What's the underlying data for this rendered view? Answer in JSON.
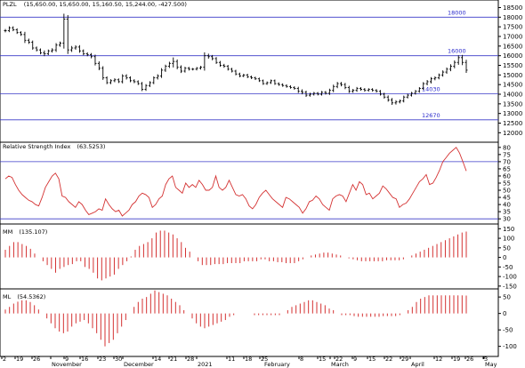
{
  "colors": {
    "hline": "#3a3ac8",
    "rsi": "#d43232",
    "bars": "#000000",
    "mm": "#d43232",
    "ml": "#d43232",
    "red_value": "#e00000",
    "frame": "#000000"
  },
  "panels": {
    "price": {
      "symbol": "PLZL",
      "ohlc": "(15,650.00, 15,650.00, 15,160.50, 15,244.00, -427.500)"
    },
    "rsi": {
      "name": "Relative Strength Index",
      "value": "(63.5253)"
    },
    "mm": {
      "name": "MM",
      "value": "(135.107)"
    },
    "ml": {
      "name": "ML",
      "value": "(54.5362)"
    }
  },
  "x_axis": {
    "labels": [
      "2",
      "19",
      "26",
      "November",
      "9",
      "16",
      "23",
      "30",
      "December",
      "14",
      "21",
      "28",
      "2021",
      "11",
      "18",
      "25",
      "February",
      "8",
      "15",
      "22",
      "March",
      "9",
      "15",
      "22",
      "29",
      "April",
      "12",
      "19",
      "26",
      "3",
      "May"
    ]
  },
  "chart_data": [
    {
      "type": "ohlc",
      "panel": "price",
      "ylim": [
        11600,
        18800
      ],
      "yticks": [
        12000,
        12500,
        13000,
        13500,
        14000,
        14500,
        15000,
        15500,
        16000,
        16500,
        17000,
        17500,
        18000,
        18500
      ],
      "levels": [
        {
          "value": 18000,
          "label": "18000"
        },
        {
          "value": 16000,
          "label": "16000"
        },
        {
          "value": 14030,
          "label": "14030"
        },
        {
          "value": 12670,
          "label": "12670"
        }
      ],
      "close": [
        17300,
        17450,
        17350,
        17200,
        17100,
        16800,
        16700,
        16400,
        16300,
        16150,
        16100,
        16250,
        16300,
        16550,
        16650,
        17900,
        16300,
        16400,
        16450,
        16250,
        16100,
        16050,
        15950,
        15600,
        15350,
        14850,
        14600,
        14700,
        14750,
        14650,
        14950,
        14850,
        14700,
        14650,
        14550,
        14250,
        14450,
        14600,
        14850,
        14950,
        15250,
        15450,
        15600,
        15700,
        15400,
        15200,
        15350,
        15300,
        15300,
        15350,
        15400,
        16000,
        15950,
        15850,
        15650,
        15500,
        15450,
        15300,
        15200,
        15050,
        14950,
        15000,
        14900,
        14850,
        14800,
        14700,
        14550,
        14600,
        14700,
        14550,
        14500,
        14450,
        14400,
        14350,
        14300,
        14150,
        14100,
        13950,
        14000,
        14050,
        14000,
        14100,
        14050,
        14200,
        14400,
        14550,
        14500,
        14350,
        14150,
        14200,
        14300,
        14250,
        14200,
        14250,
        14200,
        14150,
        14000,
        13850,
        13700,
        13550,
        13600,
        13650,
        13850,
        13950,
        14050,
        14150,
        14300,
        14550,
        14650,
        14800,
        14850,
        15000,
        15150,
        15300,
        15450,
        15650,
        15900,
        15650,
        15250
      ],
      "range": [
        240,
        220,
        220,
        200,
        200,
        400,
        250,
        250,
        220,
        220,
        350,
        200,
        250,
        300,
        250,
        800,
        600,
        300,
        250,
        280,
        220,
        220,
        250,
        300,
        300,
        300,
        220,
        220,
        220,
        200,
        250,
        250,
        220,
        220,
        200,
        250,
        220,
        220,
        220,
        250,
        300,
        250,
        250,
        600,
        300,
        280,
        220,
        200,
        180,
        180,
        200,
        500,
        300,
        250,
        220,
        220,
        220,
        200,
        200,
        200,
        200,
        180,
        180,
        180,
        180,
        180,
        180,
        180,
        180,
        180,
        180,
        180,
        180,
        180,
        180,
        250,
        300,
        250,
        220,
        200,
        180,
        200,
        200,
        250,
        280,
        250,
        250,
        250,
        250,
        220,
        220,
        200,
        200,
        180,
        180,
        180,
        200,
        220,
        250,
        300,
        250,
        220,
        220,
        200,
        200,
        200,
        200,
        220,
        250,
        250,
        220,
        220,
        250,
        250,
        300,
        300,
        350,
        400,
        400
      ]
    },
    {
      "type": "line",
      "panel": "rsi",
      "name": "Relative Strength Index",
      "ylim": [
        27,
        83
      ],
      "yticks": [
        30,
        35,
        40,
        45,
        50,
        55,
        60,
        65,
        70,
        75,
        80
      ],
      "levels": [
        70,
        30
      ],
      "values": [
        58,
        60,
        59,
        54,
        50,
        47,
        45,
        43,
        42,
        40,
        39,
        45,
        52,
        56,
        60,
        62,
        58,
        46,
        45,
        42,
        40,
        38,
        42,
        40,
        36,
        33,
        34,
        35,
        37,
        36,
        44,
        40,
        37,
        35,
        36,
        32,
        34,
        36,
        40,
        42,
        46,
        48,
        47,
        45,
        38,
        40,
        44,
        46,
        54,
        58,
        60,
        52,
        50,
        48,
        55,
        52,
        54,
        52,
        57,
        54,
        50,
        50,
        52,
        60,
        52,
        50,
        52,
        57,
        52,
        47,
        46,
        47,
        44,
        39,
        37,
        40,
        45,
        48,
        50,
        47,
        44,
        42,
        40,
        38,
        45,
        44,
        42,
        40,
        38,
        34,
        37,
        42,
        43,
        46,
        44,
        40,
        38,
        36,
        44,
        46,
        47,
        46,
        42,
        48,
        54,
        50,
        56,
        54,
        47,
        48,
        44,
        46,
        48,
        53,
        51,
        48,
        45,
        44,
        38,
        40,
        41,
        44,
        48,
        52,
        56,
        58,
        61,
        54,
        55,
        59,
        64,
        70,
        73,
        76,
        78,
        80,
        76,
        70,
        63.5
      ]
    },
    {
      "type": "bar",
      "panel": "mm",
      "name": "MM",
      "ylim": [
        -160,
        170
      ],
      "yticks": [
        150,
        100,
        50,
        0,
        -50,
        -100,
        -150
      ],
      "values": [
        40,
        60,
        80,
        80,
        70,
        60,
        45,
        20,
        0,
        -20,
        -40,
        -60,
        -80,
        -60,
        -50,
        -40,
        -35,
        -20,
        -20,
        -50,
        -60,
        -80,
        -110,
        -120,
        -110,
        -100,
        -90,
        -60,
        -40,
        -20,
        5,
        40,
        60,
        70,
        80,
        100,
        130,
        140,
        140,
        130,
        120,
        100,
        80,
        50,
        30,
        0,
        -20,
        -40,
        -40,
        -40,
        -35,
        -35,
        -35,
        -30,
        -30,
        -30,
        -30,
        -20,
        -20,
        -20,
        -20,
        -10,
        -10,
        -20,
        -20,
        -25,
        -25,
        -30,
        -30,
        -30,
        -20,
        -10,
        0,
        10,
        15,
        20,
        25,
        25,
        20,
        15,
        10,
        0,
        -5,
        -10,
        -15,
        -20,
        -20,
        -20,
        -20,
        -20,
        -20,
        -15,
        -15,
        -15,
        -15,
        -10,
        0,
        10,
        20,
        30,
        40,
        50,
        60,
        70,
        80,
        90,
        100,
        110,
        120,
        130,
        135
      ]
    },
    {
      "type": "bar",
      "panel": "ml",
      "name": "ML",
      "ylim": [
        -128,
        72
      ],
      "yticks": [
        50,
        0,
        -50,
        -100
      ],
      "values": [
        12,
        20,
        30,
        36,
        40,
        40,
        35,
        25,
        12,
        0,
        -15,
        -30,
        -45,
        -55,
        -60,
        -55,
        -40,
        -30,
        -25,
        -20,
        -30,
        -45,
        -60,
        -80,
        -100,
        -90,
        -80,
        -60,
        -40,
        -20,
        0,
        20,
        35,
        45,
        50,
        60,
        70,
        65,
        60,
        55,
        45,
        35,
        25,
        10,
        0,
        -15,
        -30,
        -40,
        -45,
        -40,
        -35,
        -30,
        -25,
        -20,
        -10,
        -5,
        0,
        0,
        0,
        0,
        -5,
        -5,
        -5,
        -5,
        -5,
        -5,
        -5,
        0,
        10,
        20,
        25,
        30,
        35,
        40,
        40,
        35,
        30,
        25,
        15,
        10,
        0,
        -5,
        -5,
        -5,
        -8,
        -10,
        -10,
        -10,
        -10,
        -10,
        -10,
        -8,
        -8,
        -8,
        -8,
        -5,
        0,
        10,
        20,
        35,
        45,
        50,
        55,
        55,
        55,
        55,
        55,
        55,
        55,
        55,
        55,
        54.5
      ]
    }
  ]
}
